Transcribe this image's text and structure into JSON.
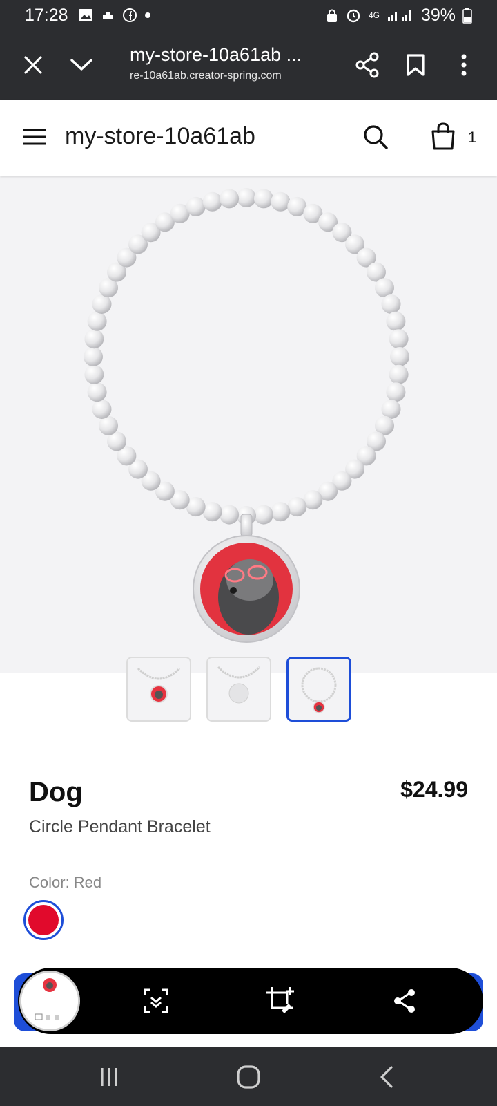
{
  "status_bar": {
    "time": "17:28",
    "battery": "39%",
    "network": "4G"
  },
  "browser": {
    "title": "my-store-10a61ab ...",
    "url": "re-10a61ab.creator-spring.com"
  },
  "store": {
    "name": "my-store-10a61ab",
    "cart_count": "1"
  },
  "product": {
    "title": "Dog",
    "subtitle": "Circle Pendant Bracelet",
    "price": "$24.99",
    "color_label": "Color: Red",
    "selected_color": "#e10a2c"
  },
  "thumbnails": [
    {
      "name": "thumbnail-bracelet-front",
      "active": false
    },
    {
      "name": "thumbnail-bracelet-back",
      "active": false
    },
    {
      "name": "thumbnail-bracelet-full",
      "active": true
    }
  ],
  "colors": {
    "accent": "#1e4ed8",
    "chrome": "#2c2d30",
    "image_bg": "#f3f3f5"
  }
}
